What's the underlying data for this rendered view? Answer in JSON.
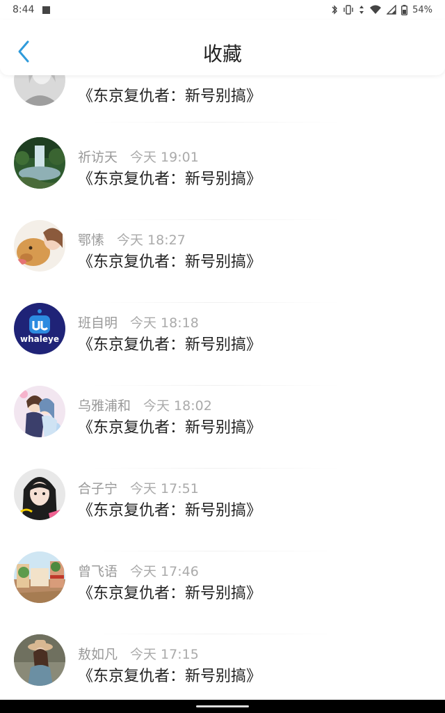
{
  "status_bar": {
    "time": "8:44",
    "battery": "54%",
    "icons": [
      "bluetooth-icon",
      "vibrate-icon",
      "data-arrows-icon",
      "wifi-icon",
      "signal-icon",
      "battery-icon"
    ]
  },
  "header": {
    "title": "收藏",
    "back_icon": "chevron-left-icon",
    "accent": "#2f9bdb"
  },
  "items": [
    {
      "name": "",
      "time": "",
      "title": "《东京复仇者：新号别搞》",
      "avatar": "portrait-gray"
    },
    {
      "name": "祈访天",
      "time": "今天 19:01",
      "title": "《东京复仇者：新号别搞》",
      "avatar": "waterfall"
    },
    {
      "name": "鄂愫",
      "time": "今天 18:27",
      "title": "《东京复仇者：新号别搞》",
      "avatar": "dog-girl"
    },
    {
      "name": "班自明",
      "time": "今天 18:18",
      "title": "《东京复仇者：新号别搞》",
      "avatar": "whaley-logo"
    },
    {
      "name": "乌雅浦和",
      "time": "今天 18:02",
      "title": "《东京复仇者：新号别搞》",
      "avatar": "anime-couple"
    },
    {
      "name": "合子宁",
      "time": "今天 17:51",
      "title": "《东京复仇者：新号别搞》",
      "avatar": "girl-portrait"
    },
    {
      "name": "曾飞语",
      "time": "今天 17:46",
      "title": "《东京复仇者：新号别搞》",
      "avatar": "street-scene"
    },
    {
      "name": "敖如凡",
      "time": "今天 17:15",
      "title": "《东京复仇者：新号别搞》",
      "avatar": "girl-hat"
    }
  ],
  "whaley_logo_text": "whaleye"
}
